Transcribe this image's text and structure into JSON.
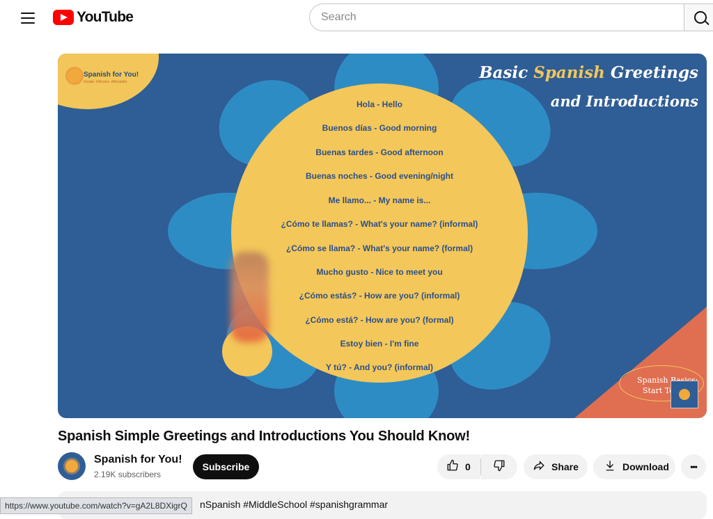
{
  "header": {
    "logo_text": "YouTube",
    "search_placeholder": "Search"
  },
  "video": {
    "brand": "Spanish for You!",
    "brand_tagline": "Simple. Effective. Affordable.",
    "overlay_title_pre": "Basic ",
    "overlay_title_highlight": "Spanish",
    "overlay_title_post": " Greetings",
    "overlay_title_line2": "and Introductions",
    "phrases": [
      "Hola - Hello",
      "Buenos días - Good morning",
      "Buenas tardes - Good afternoon",
      "Buenas noches - Good evening/night",
      "Me llamo... - My name is...",
      "¿Cómo te llamas? - What's your name? (informal)",
      "¿Cómo se llama? - What's your name? (formal)",
      "Mucho gusto - Nice to meet you",
      "¿Cómo estás? - How are you? (informal)",
      "¿Cómo está? - How are you? (formal)",
      "Estoy bien - I'm fine",
      "Y tú? - And you? (informal)"
    ],
    "badge_line1": "Spanish Basics:",
    "badge_line2": "Start To"
  },
  "details": {
    "title": "Spanish Simple Greetings and Introductions You Should Know!",
    "channel_name": "Spanish for You!",
    "subscribers": "2.19K subscribers",
    "subscribe_label": "Subscribe",
    "like_count": "0",
    "share_label": "Share",
    "download_label": "Download",
    "more_label": "•••"
  },
  "description": {
    "tags_visible": "nSpanish #MiddleSchool #spanishgrammar"
  },
  "status_bar": {
    "url": "https://www.youtube.com/watch?v=gA2L8DXigrQ"
  },
  "colors": {
    "brand_red": "#ff0000",
    "video_blue": "#2f5d95",
    "petal_blue": "#2e8cc4",
    "sun_yellow": "#f3c75a",
    "coral": "#e06f52"
  }
}
